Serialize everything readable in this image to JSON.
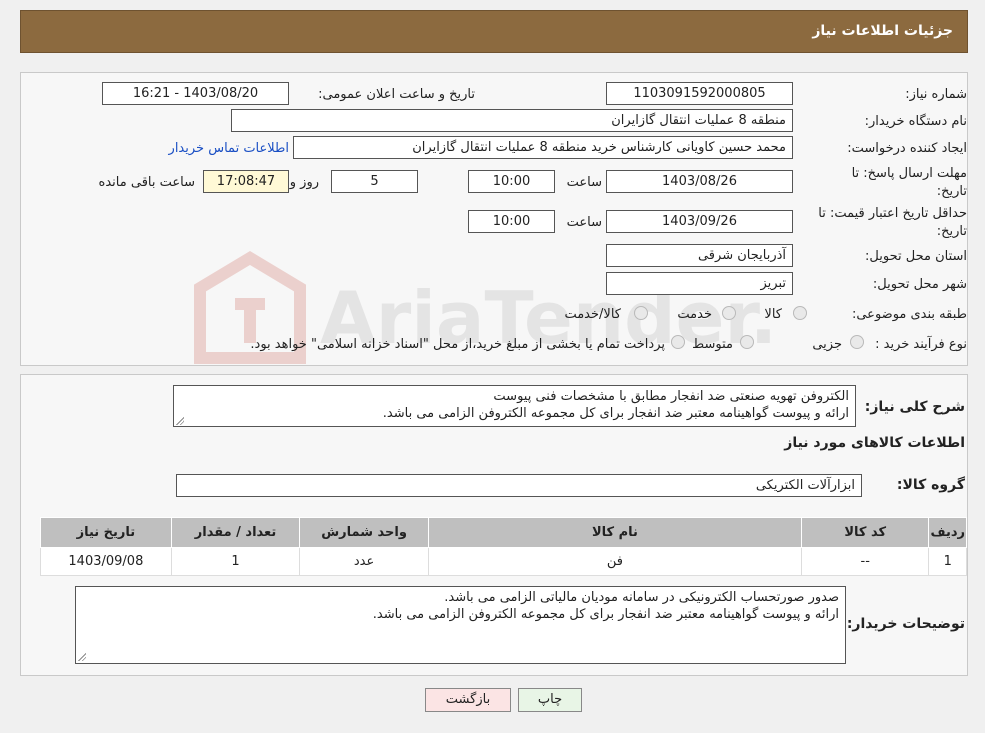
{
  "header": {
    "title": "جزئیات اطلاعات نیاز"
  },
  "form": {
    "need_number_label": "شماره نیاز:",
    "need_number": "1103091592000805",
    "announce_label": "تاریخ و ساعت اعلان عمومی:",
    "announce_value": "1403/08/20 - 16:21",
    "buyer_org_label": "نام دستگاه خریدار:",
    "buyer_org": "منطقه 8 عملیات انتقال گازایران",
    "creator_label": "ایجاد کننده درخواست:",
    "creator": "محمد حسین کاویانی کارشناس خرید منطقه 8 عملیات انتقال گازایران",
    "contact_link": "اطلاعات تماس خریدار",
    "deadline_label_1": "مهلت ارسال پاسخ: تا",
    "deadline_label_2": "تاریخ:",
    "deadline_date": "1403/08/26",
    "time_label": "ساعت",
    "deadline_time": "10:00",
    "days_value": "5",
    "days_label": "روز و",
    "remaining_time": "17:08:47",
    "remaining_label": "ساعت باقی مانده",
    "validity_label_1": "حداقل تاریخ اعتبار قیمت: تا",
    "validity_label_2": "تاریخ:",
    "validity_date": "1403/09/26",
    "validity_time": "10:00",
    "province_label": "استان محل تحویل:",
    "province": "آذربایجان شرقی",
    "city_label": "شهر محل تحویل:",
    "city": "تبریز",
    "category_label": "طبقه بندی موضوعی:",
    "category_options": [
      "کالا",
      "خدمت",
      "کالا/خدمت"
    ],
    "process_label": "نوع فرآیند خرید :",
    "process_options": [
      "جزیی",
      "متوسط"
    ],
    "process_note": "پرداخت تمام یا بخشی از مبلغ خرید،از محل \"اسناد خزانه اسلامی\" خواهد بود."
  },
  "description": {
    "label": "شرح کلی نیاز:",
    "text": "الکتروفن تهویه صنعتی ضد انفجار مطابق با مشخصات فنی پیوست\nارائه و پیوست گواهینامه معتبر ضد انفجار برای کل مجموعه الکتروفن الزامی می باشد."
  },
  "goods": {
    "section_title": "اطلاعات کالاهای مورد نیاز",
    "group_label": "گروه کالا:",
    "group_value": "ابزارآلات الکتریکی",
    "columns": [
      "ردیف",
      "کد کالا",
      "نام کالا",
      "واحد شمارش",
      "تعداد / مقدار",
      "تاریخ نیاز"
    ],
    "rows": [
      [
        "1",
        "--",
        "فن",
        "عدد",
        "1",
        "1403/09/08"
      ]
    ]
  },
  "buyer_notes": {
    "label": "توضیحات خریدار:",
    "text": "صدور صورتحساب الکترونیکی در سامانه مودیان مالیاتی الزامی می باشد.\nارائه و پیوست گواهینامه معتبر ضد انفجار برای کل مجموعه الکتروفن الزامی می باشد."
  },
  "buttons": {
    "print": "چاپ",
    "back": "بازگشت"
  },
  "watermark": {
    "text": "AriaTender.neT"
  },
  "colors": {
    "header": "#8c6a3f",
    "link": "#1a4fc4",
    "remaining_bg": "#fff9d6"
  }
}
